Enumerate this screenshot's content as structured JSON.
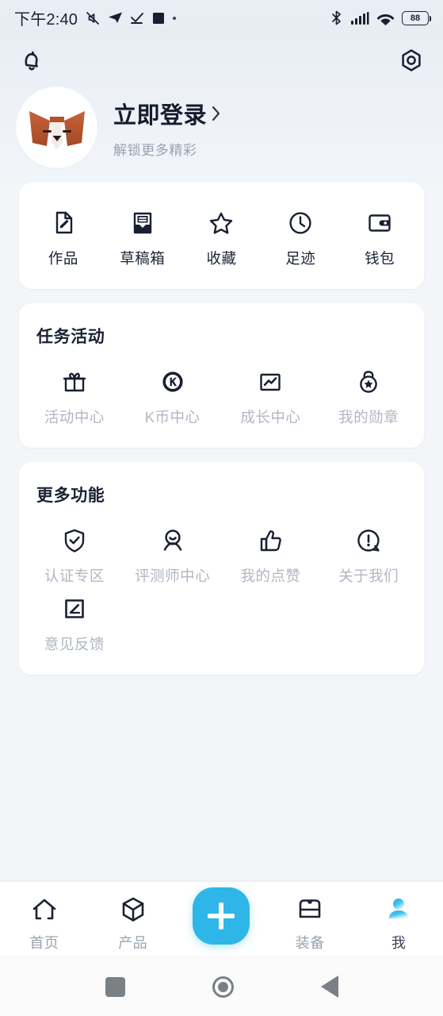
{
  "statusbar": {
    "time": "下午2:40",
    "battery": "88",
    "icons_left": [
      "mute-icon",
      "telegram-icon",
      "checkmark-icon",
      "square-icon",
      "dot-icon"
    ],
    "icons_right": [
      "bluetooth-icon",
      "signal-icon",
      "wifi-icon",
      "battery-icon"
    ]
  },
  "header": {
    "bell_icon": "bell-icon",
    "settings_icon": "settings-gear-icon",
    "avatar_icon": "dog-avatar",
    "login_label": "立即登录",
    "subtitle": "解锁更多精彩",
    "accent": "#2eb6e8",
    "bg": "#eef2f7"
  },
  "quick_card": {
    "items": [
      {
        "label": "作品",
        "icon": "document-pencil-icon"
      },
      {
        "label": "草稿箱",
        "icon": "inbox-icon"
      },
      {
        "label": "收藏",
        "icon": "star-icon"
      },
      {
        "label": "足迹",
        "icon": "clock-icon"
      },
      {
        "label": "钱包",
        "icon": "wallet-icon"
      }
    ]
  },
  "tasks_card": {
    "title": "任务活动",
    "items": [
      {
        "label": "活动中心",
        "icon": "gift-icon"
      },
      {
        "label": "K币中心",
        "icon": "k-coin-icon"
      },
      {
        "label": "成长中心",
        "icon": "growth-chart-icon"
      },
      {
        "label": "我的勋章",
        "icon": "medal-icon"
      }
    ]
  },
  "more_card": {
    "title": "更多功能",
    "items": [
      {
        "label": "认证专区",
        "icon": "shield-check-icon"
      },
      {
        "label": "评测师中心",
        "icon": "reviewer-person-icon"
      },
      {
        "label": "我的点赞",
        "icon": "thumbs-up-icon"
      },
      {
        "label": "关于我们",
        "icon": "info-exclamation-icon"
      },
      {
        "label": "意见反馈",
        "icon": "feedback-pencil-icon"
      }
    ]
  },
  "bottomnav": {
    "items": [
      {
        "label": "首页",
        "icon": "home-icon",
        "active": false
      },
      {
        "label": "产品",
        "icon": "cube-icon",
        "active": false
      },
      {
        "label": "装备",
        "icon": "box-icon",
        "active": false
      },
      {
        "label": "我",
        "icon": "person-icon",
        "active": true
      }
    ],
    "fab_icon": "plus-icon"
  },
  "sysnav": {
    "recents_icon": "square-icon",
    "home_icon": "circle-icon",
    "back_icon": "triangle-back-icon"
  }
}
